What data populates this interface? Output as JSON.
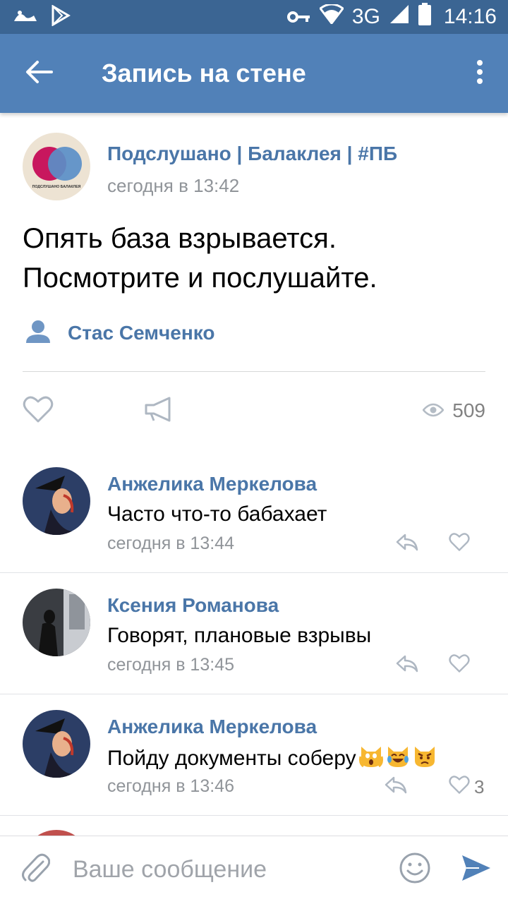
{
  "status_bar": {
    "time": "14:16",
    "network": "3G",
    "icons": [
      "notification-app-icon",
      "play-store-icon",
      "vpn-key-icon",
      "wifi-icon",
      "signal-icon",
      "battery-icon"
    ]
  },
  "app_bar": {
    "title": "Запись на стене",
    "icons": [
      "back-arrow-icon",
      "more-vertical-icon"
    ]
  },
  "post": {
    "group_name": "Подслушано | Балаклея | #ПБ",
    "time": "сегодня в 13:42",
    "avatar_text": "ПОДСЛУШАНО БАЛАКЛЕЯ",
    "text_line1": "Опять база взрывается.",
    "text_line2": "Посмотрите и послушайте.",
    "author": "Стас Семченко",
    "views": "509"
  },
  "comments": [
    {
      "author": "Анжелика Меркелова",
      "text": "Часто что-то бабахает",
      "time": "сегодня в 13:44",
      "likes": ""
    },
    {
      "author": "Ксения Романова",
      "text": "Говорят, плановые взрывы",
      "time": "сегодня в 13:45",
      "likes": ""
    },
    {
      "author": "Анжелика Меркелова",
      "text": "Пойду документы соберу",
      "time": "сегодня в 13:46",
      "likes": "3",
      "emojis": [
        "scream-cat-emoji",
        "tears-of-joy-cat-emoji",
        "pouting-cat-emoji"
      ]
    }
  ],
  "composer": {
    "placeholder": "Ваше сообщение"
  },
  "colors": {
    "status_bar": "#3b6593",
    "app_bar": "#5181b8",
    "link": "#4a76a8",
    "secondary_text": "#909499",
    "send": "#5181b8"
  }
}
